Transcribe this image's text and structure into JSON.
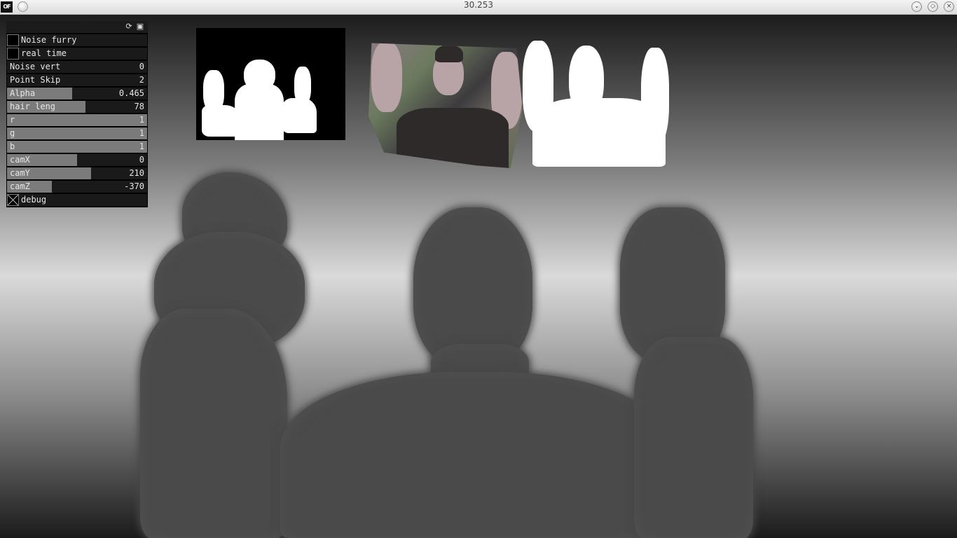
{
  "window": {
    "title": "30.253",
    "logo_text": "OF"
  },
  "panel": {
    "header_icons": [
      "reload-icon",
      "save-icon"
    ],
    "controls": [
      {
        "type": "toggle",
        "label": "Noise furry",
        "checked": false
      },
      {
        "type": "toggle",
        "label": "real time",
        "checked": false
      },
      {
        "type": "slider",
        "label": "Noise vert",
        "value": "0",
        "fraction": 0
      },
      {
        "type": "slider",
        "label": "Point Skip",
        "value": "2",
        "fraction": 0
      },
      {
        "type": "slider",
        "label": "Alpha",
        "value": "0.465",
        "fraction": 0.465
      },
      {
        "type": "slider",
        "label": "hair leng",
        "value": "78",
        "fraction": 0.56
      },
      {
        "type": "slider",
        "label": "r",
        "value": "1",
        "fraction": 1
      },
      {
        "type": "slider",
        "label": "g",
        "value": "1",
        "fraction": 1
      },
      {
        "type": "slider",
        "label": "b",
        "value": "1",
        "fraction": 1
      },
      {
        "type": "slider",
        "label": "camX",
        "value": "0",
        "fraction": 0.5
      },
      {
        "type": "slider",
        "label": "camY",
        "value": "210",
        "fraction": 0.6
      },
      {
        "type": "slider",
        "label": "camZ",
        "value": "-370",
        "fraction": 0.32
      },
      {
        "type": "toggle",
        "label": "debug",
        "checked": true
      }
    ]
  },
  "colors": {
    "panel_bg": "#000000",
    "slider_fill": "#7b7b7b",
    "fur": "#4a4a4a"
  }
}
